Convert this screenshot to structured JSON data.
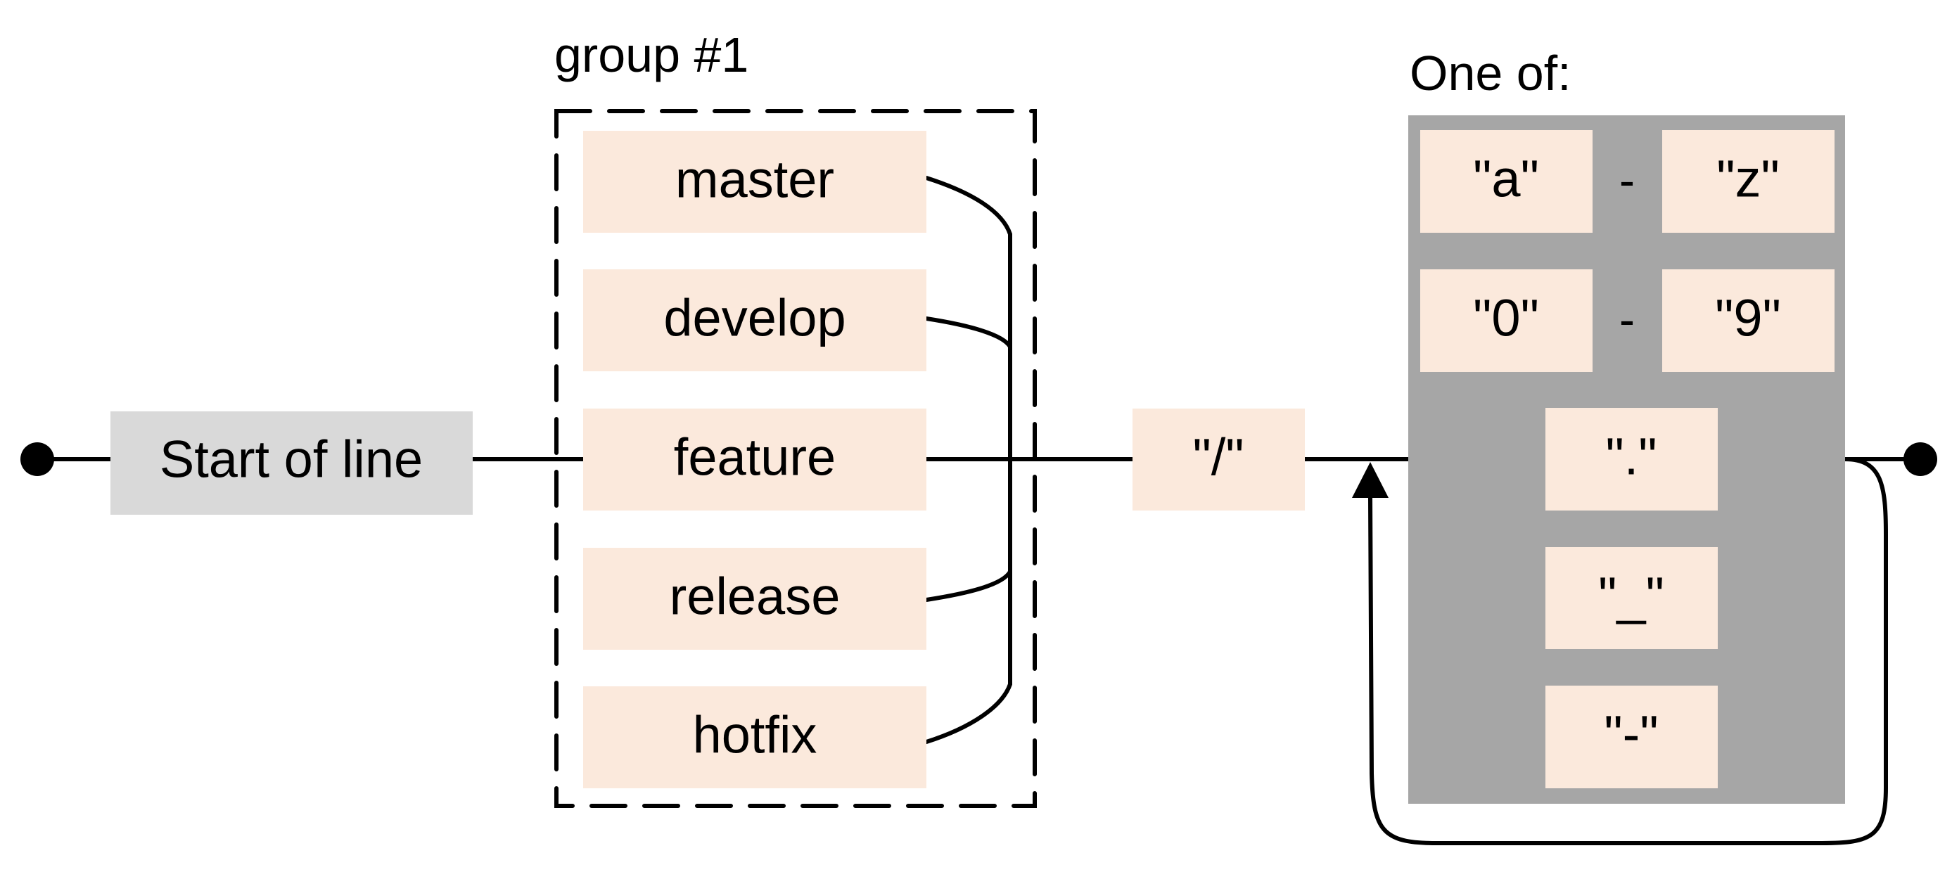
{
  "diagram": {
    "type": "railroad",
    "start": {
      "label": "Start of line"
    },
    "group": {
      "label": "group #1",
      "alternatives": [
        "master",
        "develop",
        "feature",
        "release",
        "hotfix"
      ]
    },
    "separator": {
      "label": "\"/\""
    },
    "one_of": {
      "label": "One of:",
      "ranges": [
        {
          "from": "\"a\"",
          "dash": "-",
          "to": "\"z\""
        },
        {
          "from": "\"0\"",
          "dash": "-",
          "to": "\"9\""
        }
      ],
      "literals": [
        "\".\"",
        "\"_\"",
        "\"-\""
      ],
      "repeat": "one or more"
    },
    "colors": {
      "literal_fill": "#fbe9dc",
      "anchor_fill": "#d9d9d9",
      "charset_fill": "#a6a6a6",
      "line": "#000000"
    }
  }
}
